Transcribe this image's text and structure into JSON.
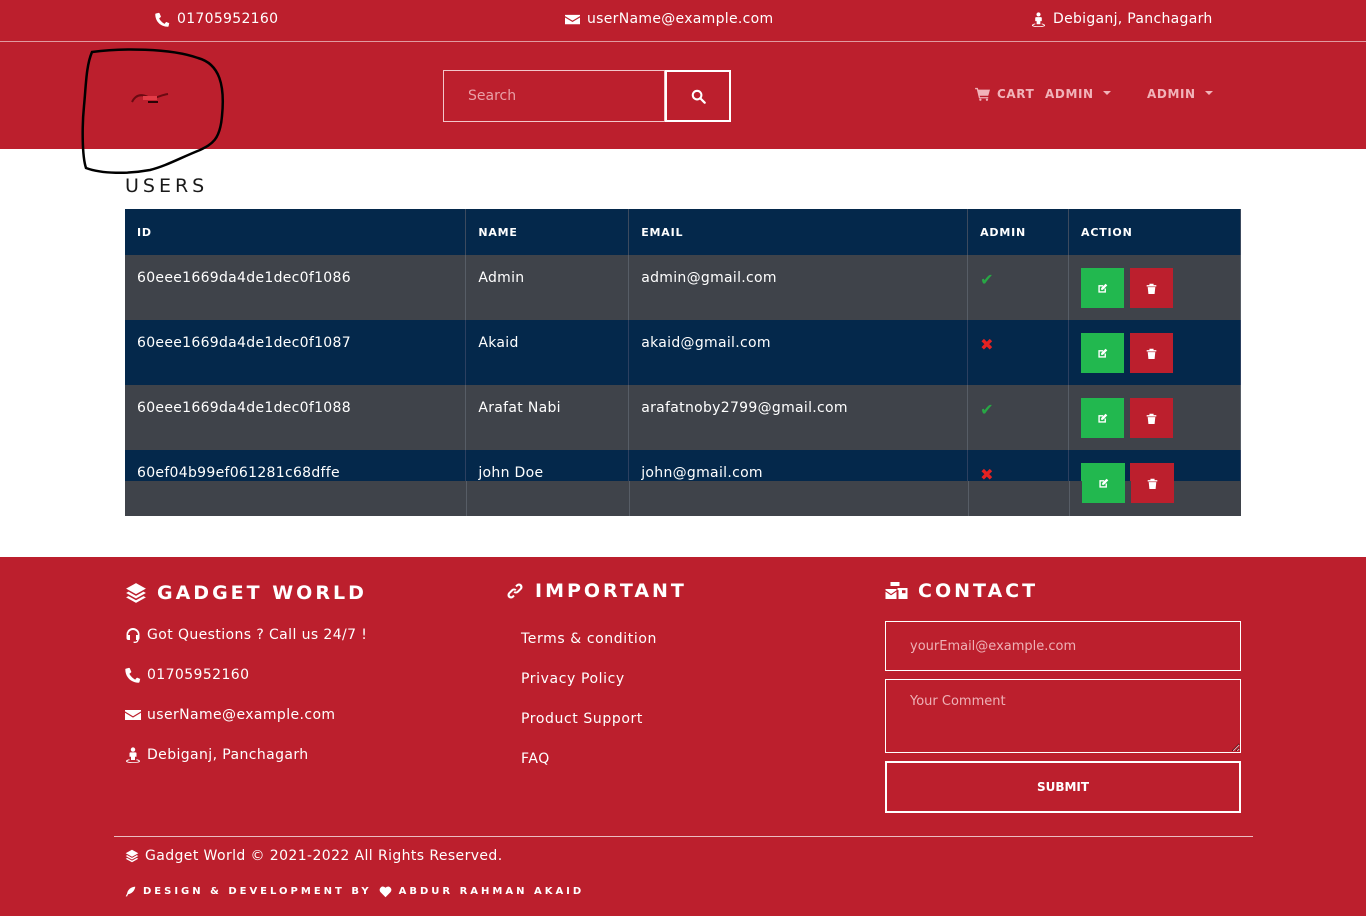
{
  "topbar": {
    "phone": "01705952160",
    "email": "userName@example.com",
    "location": "Debiganj, Panchagarh"
  },
  "header": {
    "search_placeholder": "Search",
    "cart_label": "CART",
    "admin_menu_1": "ADMIN",
    "admin_menu_2": "ADMIN"
  },
  "content": {
    "title": "USERS",
    "columns": [
      "ID",
      "NAME",
      "EMAIL",
      "ADMIN",
      "ACTION"
    ],
    "rows": [
      {
        "id": "60eee1669da4de1dec0f1086",
        "name": "Admin",
        "email": "admin@gmail.com",
        "admin": true
      },
      {
        "id": "60eee1669da4de1dec0f1087",
        "name": "Akaid",
        "email": "akaid@gmail.com",
        "admin": false
      },
      {
        "id": "60eee1669da4de1dec0f1088",
        "name": "Arafat Nabi",
        "email": "arafatnoby2799@gmail.com",
        "admin": true
      },
      {
        "id": "60ef04b99ef061281c68dffe",
        "name": "john Doe",
        "email": "john@gmail.com",
        "admin": false
      }
    ]
  },
  "footer": {
    "brand": "GADGET WORLD",
    "questions": "Got Questions ? Call us 24/7 !",
    "phone": "01705952160",
    "email": "userName@example.com",
    "location": "Debiganj, Panchagarh",
    "important_title": "IMPORTANT",
    "links": [
      "Terms & condition",
      "Privacy Policy",
      "Product Support",
      "FAQ"
    ],
    "contact_title": "CONTACT",
    "email_placeholder": "yourEmail@example.com",
    "comment_placeholder": "Your Comment",
    "submit_label": "SUBMIT",
    "copyright": "Gadget World © 2021-2022 All Rights Reserved.",
    "credit_prefix": "DESIGN & DEVELOPMENT BY",
    "credit_name": "ABDUR RAHMAN AKAID"
  },
  "colors": {
    "brand_red": "#bc1f2d",
    "table_navy": "#04284b",
    "table_gray": "#3f434a",
    "edit_green": "#22b84f"
  }
}
